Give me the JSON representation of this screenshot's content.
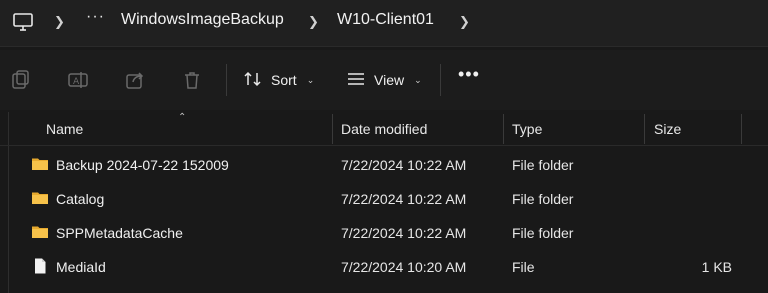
{
  "address_bar": {
    "root_icon": "computer-icon",
    "overflow_label": "···",
    "breadcrumbs": [
      "WindowsImageBackup",
      "W10-Client01"
    ]
  },
  "command_bar": {
    "icons": [
      "copy-icon",
      "rename-icon",
      "share-icon",
      "delete-icon"
    ],
    "sort_label": "Sort",
    "view_label": "View",
    "more_label": "•••"
  },
  "columns": {
    "name": "Name",
    "date": "Date modified",
    "type": "Type",
    "size": "Size"
  },
  "rows": [
    {
      "name": "Backup 2024-07-22 152009",
      "date": "7/22/2024 10:22 AM",
      "type": "File folder",
      "size": "",
      "icon": "folder-icon"
    },
    {
      "name": "Catalog",
      "date": "7/22/2024 10:22 AM",
      "type": "File folder",
      "size": "",
      "icon": "folder-icon"
    },
    {
      "name": "SPPMetadataCache",
      "date": "7/22/2024 10:22 AM",
      "type": "File folder",
      "size": "",
      "icon": "folder-icon"
    },
    {
      "name": "MediaId",
      "date": "7/22/2024 10:20 AM",
      "type": "File",
      "size": "1 KB",
      "icon": "file-icon"
    }
  ],
  "colors": {
    "folder": "#f7c24a",
    "background": "#191919"
  }
}
